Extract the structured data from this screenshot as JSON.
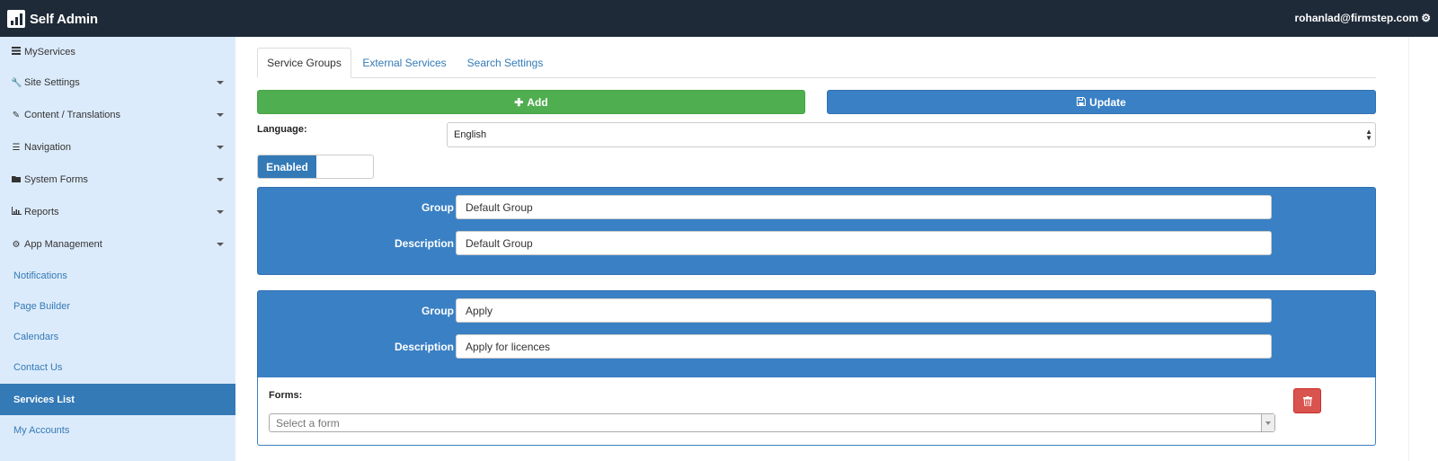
{
  "header": {
    "brand": "Self Admin",
    "user_email": "rohanlad@firmstep.com"
  },
  "sidebar": {
    "items": [
      {
        "label": "MyServices",
        "icon": "list-icon",
        "has_caret": false
      },
      {
        "label": "Site Settings",
        "icon": "wrench-icon",
        "has_caret": true
      },
      {
        "label": "Content / Translations",
        "icon": "pencil-icon",
        "has_caret": true
      },
      {
        "label": "Navigation",
        "icon": "menu-icon",
        "has_caret": true
      },
      {
        "label": "System Forms",
        "icon": "folder-icon",
        "has_caret": true
      },
      {
        "label": "Reports",
        "icon": "bar-chart-icon",
        "has_caret": true
      },
      {
        "label": "App Management",
        "icon": "gear-icon",
        "has_caret": true
      }
    ],
    "links": [
      {
        "label": "Notifications",
        "active": false
      },
      {
        "label": "Page Builder",
        "active": false
      },
      {
        "label": "Calendars",
        "active": false
      },
      {
        "label": "Contact Us",
        "active": false
      },
      {
        "label": "Services List",
        "active": true
      },
      {
        "label": "My Accounts",
        "active": false
      }
    ]
  },
  "tabs": [
    {
      "label": "Service Groups",
      "active": true
    },
    {
      "label": "External Services",
      "active": false
    },
    {
      "label": "Search Settings",
      "active": false
    }
  ],
  "toolbar": {
    "add_label": "Add",
    "update_label": "Update"
  },
  "language": {
    "label": "Language:",
    "value": "English"
  },
  "toggle": {
    "label": "Enabled",
    "state": "on"
  },
  "groups": [
    {
      "group_label": "Group",
      "group_value": "Default Group",
      "description_label": "Description",
      "description_value": "Default Group"
    },
    {
      "group_label": "Group",
      "group_value": "Apply",
      "description_label": "Description",
      "description_value": "Apply for licences"
    }
  ],
  "forms": {
    "label": "Forms:",
    "placeholder": "Select a form"
  },
  "colors": {
    "topbar": "#1f2a38",
    "sidebar": "#dcebfb",
    "primary": "#337ab7",
    "success": "#4fae4f",
    "danger": "#d9534f"
  }
}
